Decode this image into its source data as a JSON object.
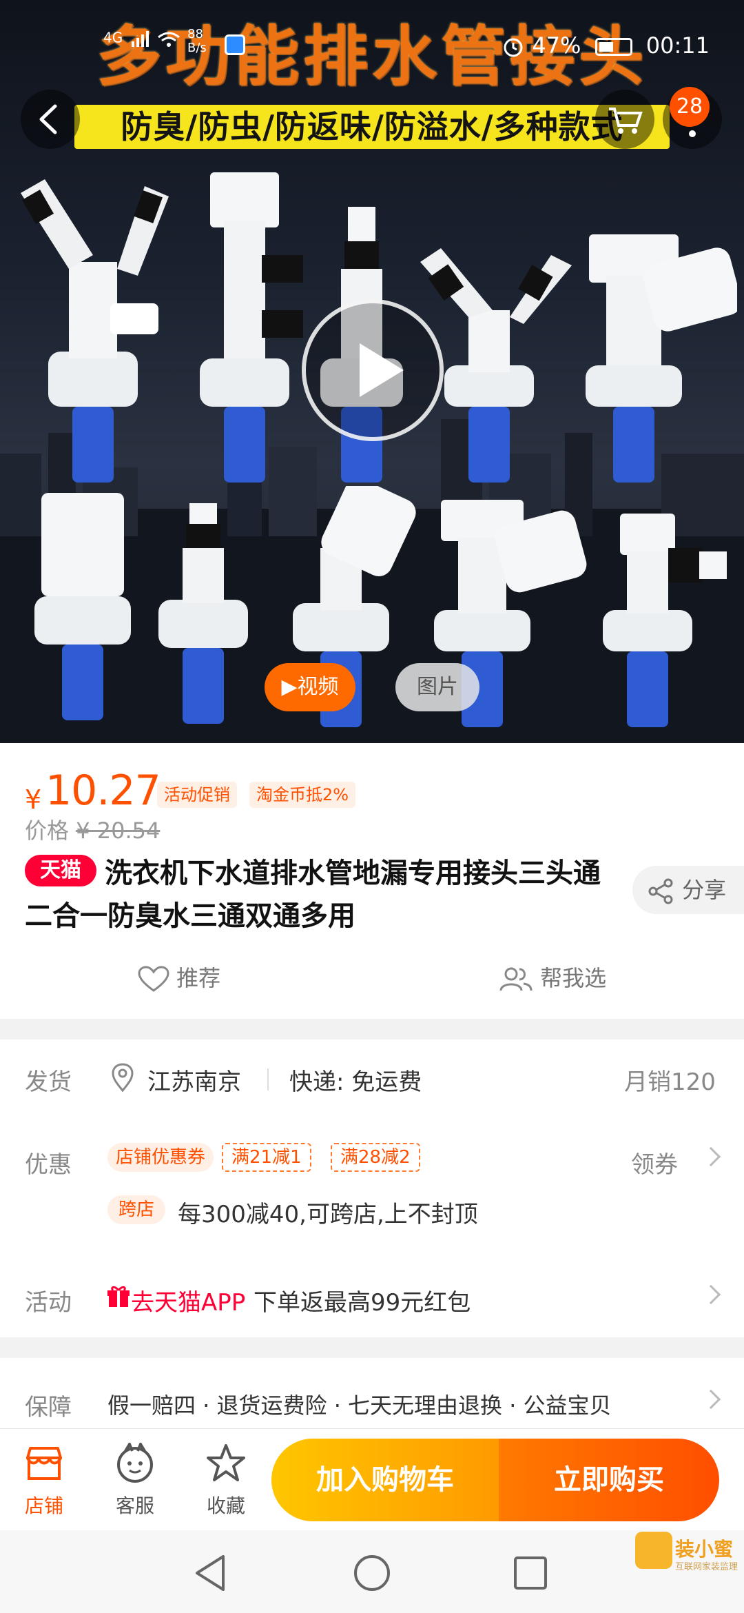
{
  "status_bar": {
    "network": "4G",
    "speed_value": "88",
    "speed_unit": "B/s",
    "battery": "47%",
    "time": "00:11"
  },
  "hero": {
    "banner_title": "多功能排水管接头",
    "banner_subtitle": "防臭/防虫/防返味/防溢水/多种款式",
    "cart_count": "28",
    "tab_video": "▶视频",
    "tab_image": "图片"
  },
  "price": {
    "currency": "¥",
    "current": "10.27",
    "tag_promo": "活动促销",
    "tag_coin": "淘金币抵2%",
    "original_label": "价格",
    "original_price": "¥ 20.54"
  },
  "product": {
    "store_badge": "天猫",
    "title": "洗衣机下水道排水管地漏专用接头三头通二合一防臭水三通双通多用",
    "share": "分享",
    "recommend": "推荐",
    "help_me_choose": "帮我选"
  },
  "shipping": {
    "label": "发货",
    "location": "江苏南京",
    "express": "快递: 免运费",
    "monthly_sales": "月销120"
  },
  "discount": {
    "label": "优惠",
    "shop_coupon": "店铺优惠券",
    "coupon_1": "满21减1",
    "coupon_2": "满28减2",
    "get_coupon": "领券",
    "cross_store_tag": "跨店",
    "cross_store_text": "每300减40,可跨店,上不封顶"
  },
  "activity": {
    "label": "活动",
    "app_link": "去天猫APP",
    "text": "下单返最高99元红包"
  },
  "guarantee": {
    "label": "保障",
    "text": "假一赔四 · 退货运费险 · 七天无理由退换 · 公益宝贝"
  },
  "action_bar": {
    "store": "店铺",
    "service": "客服",
    "favorite": "收藏",
    "add_to_cart": "加入购物车",
    "buy_now": "立即购买"
  },
  "watermark": {
    "brand": "装小蜜",
    "tagline": "互联网家装监理"
  },
  "colors": {
    "accent": "#ff5000",
    "tmall_red": "#ff0036",
    "cart_button": "#ffb000",
    "buy_button": "#ff5a00"
  }
}
